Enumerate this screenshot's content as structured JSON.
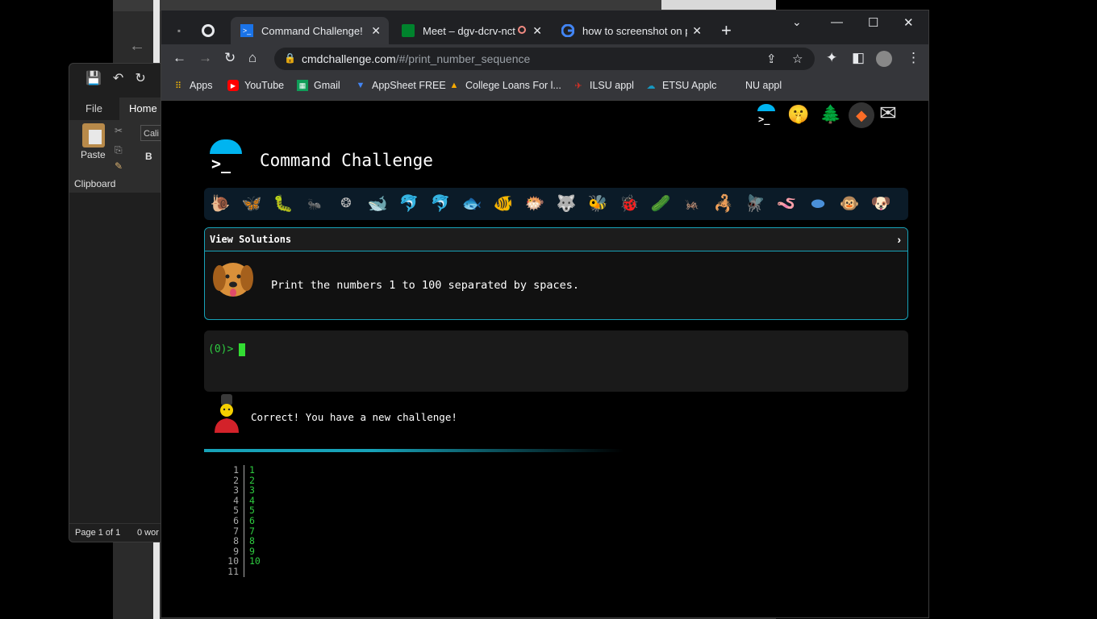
{
  "word": {
    "tabs": [
      "File",
      "Home"
    ],
    "paste_label": "Paste",
    "font_box": "Cali",
    "bold_label": "B",
    "group_label": "Clipboard",
    "status_page": "Page 1 of 1",
    "status_words": "0 wor"
  },
  "chrome": {
    "tabs": [
      {
        "title": "Command Challenge!",
        "active": true
      },
      {
        "title": "Meet – dgv-dcrv-nct",
        "active": false
      },
      {
        "title": "how to screenshot on pc",
        "active": false
      }
    ],
    "new_tab": "+",
    "url_host": "cmdchallenge.com",
    "url_path": "/#/print_number_sequence",
    "bookmarks": [
      "Apps",
      "YouTube",
      "Gmail",
      "AppSheet FREE",
      "College Loans For l...",
      "ILSU appl",
      "ETSU Applc",
      "NU appl"
    ]
  },
  "page": {
    "title": "Command Challenge",
    "view_solutions": "View Solutions",
    "challenge_text": "Print the numbers 1 to 100 separated by spaces.",
    "prompt": "(0)>",
    "feedback": "Correct! You have a new challenge!",
    "output_lines": [
      {
        "n": "1",
        "v": "1"
      },
      {
        "n": "2",
        "v": "2"
      },
      {
        "n": "3",
        "v": "3"
      },
      {
        "n": "4",
        "v": "4"
      },
      {
        "n": "5",
        "v": "5"
      },
      {
        "n": "6",
        "v": "6"
      },
      {
        "n": "7",
        "v": "7"
      },
      {
        "n": "8",
        "v": "8"
      },
      {
        "n": "9",
        "v": "9"
      },
      {
        "n": "10",
        "v": "10"
      },
      {
        "n": "11",
        "v": ""
      }
    ],
    "animals": [
      "snail-icon",
      "butterfly-icon",
      "caterpillar-icon",
      "ant-icon",
      "spider-web-icon",
      "whale-icon",
      "dolphin-icon",
      "dolphin2-icon",
      "fish-icon",
      "tropical-fish-icon",
      "blowfish-icon",
      "wolf-icon",
      "bee-icon",
      "ladybug-icon",
      "cucumber-icon",
      "bug-icon",
      "scorpion-icon",
      "fly-icon",
      "worm-icon",
      "amoeba-icon",
      "monkey-icon",
      "dog-icon"
    ],
    "top_icons": [
      "terminal-icon",
      "shush-face-icon",
      "tree-icon",
      "gitlab-icon",
      "mail-icon"
    ]
  },
  "colors": {
    "accent": "#17a2b8",
    "prompt_green": "#2ecc40",
    "chrome_bg": "#202124",
    "toolbar_bg": "#35363a"
  }
}
